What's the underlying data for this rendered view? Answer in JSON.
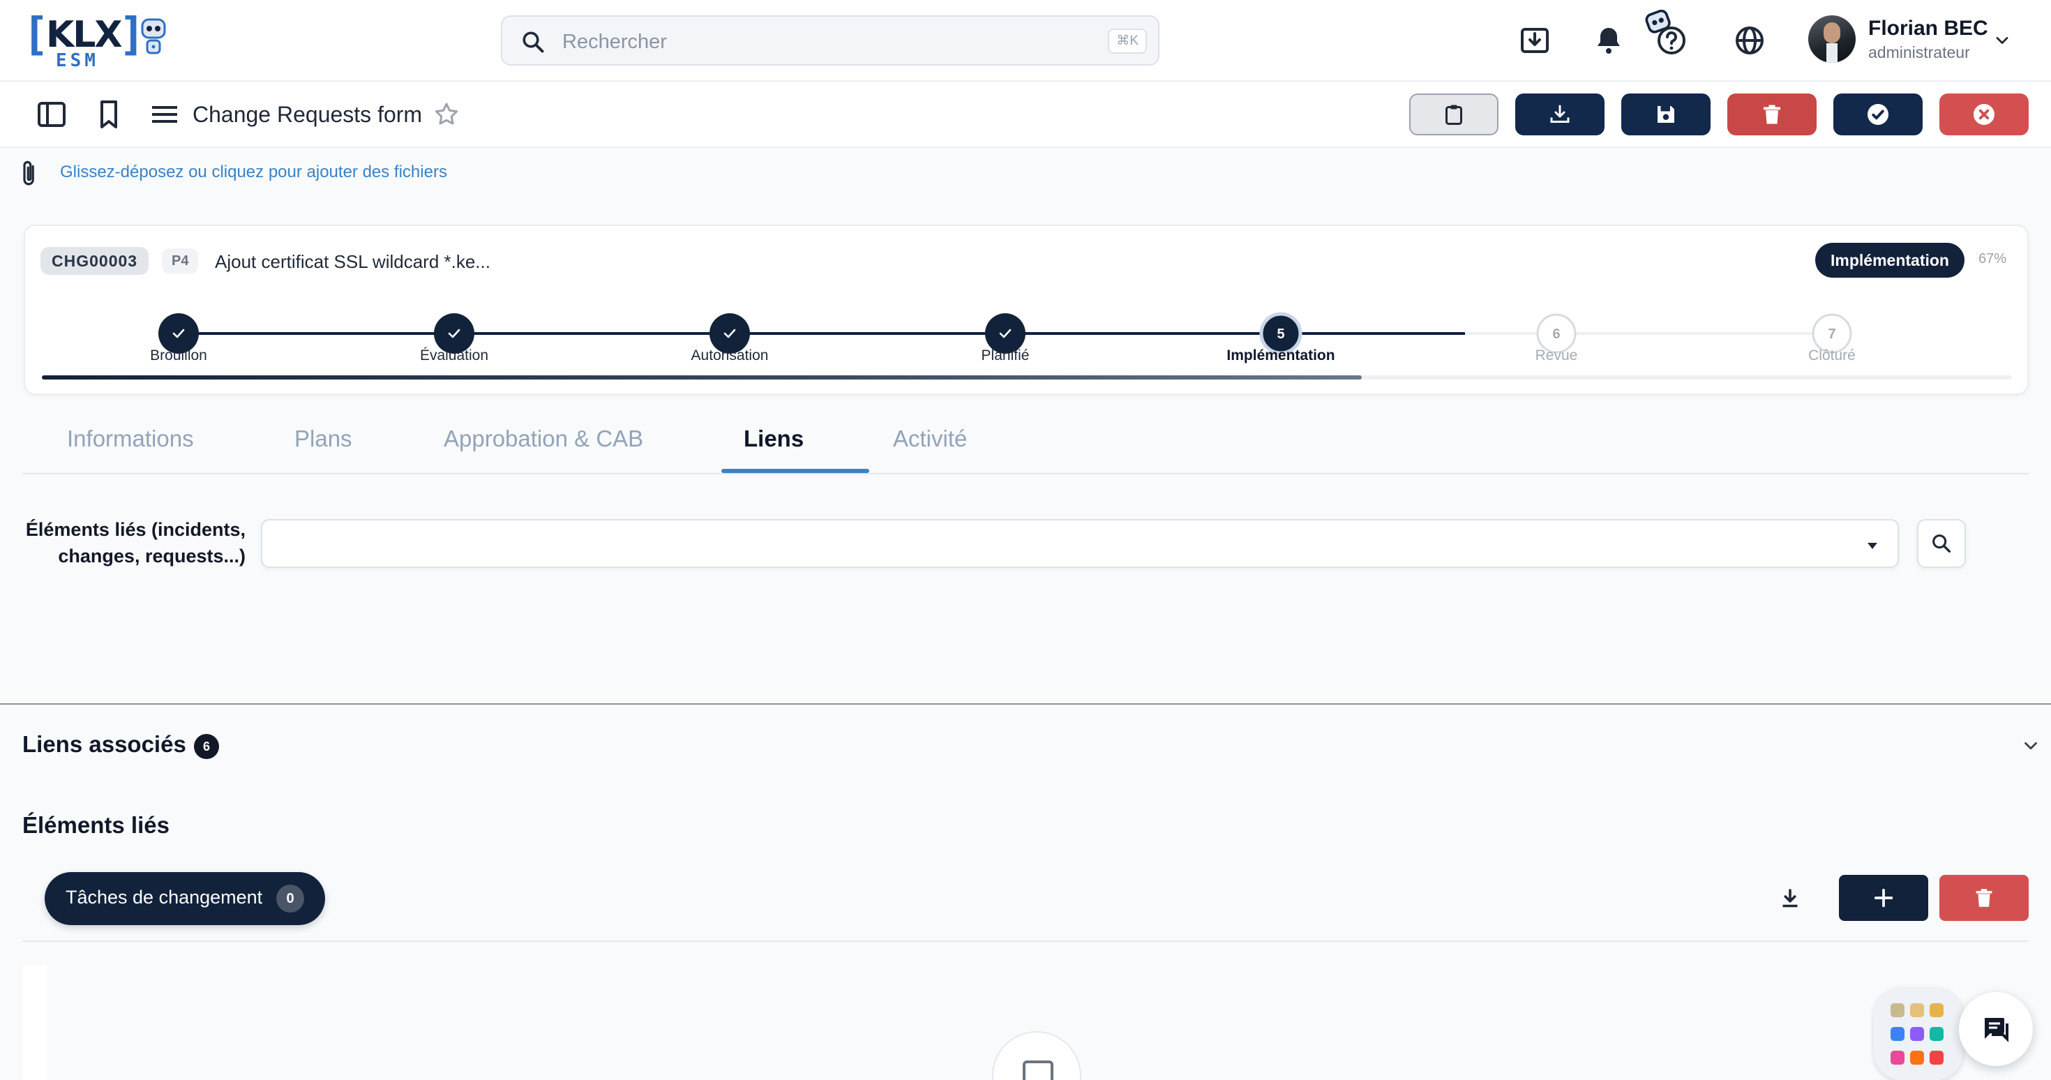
{
  "app": {
    "logo_text": "KLX",
    "logo_sub": "ESM"
  },
  "header": {
    "search_placeholder": "Rechercher",
    "search_shortcut": "⌘K",
    "user_name": "Florian BEC",
    "user_role": "administrateur"
  },
  "toolbar": {
    "form_title": "Change Requests form"
  },
  "attachments": {
    "hint": "Glissez-déposez ou cliquez pour ajouter des fichiers"
  },
  "record": {
    "id": "CHG00003",
    "priority": "P4",
    "title": "Ajout certificat SSL wildcard *.ke...",
    "status": "Implémentation",
    "progress_label": "67%",
    "progress": 0.67,
    "steps": [
      {
        "label": "Brouillon",
        "state": "done",
        "num": "1"
      },
      {
        "label": "Évaluation",
        "state": "done",
        "num": "2"
      },
      {
        "label": "Autorisation",
        "state": "done",
        "num": "3"
      },
      {
        "label": "Planifié",
        "state": "done",
        "num": "4"
      },
      {
        "label": "Implémentation",
        "state": "active",
        "num": "5"
      },
      {
        "label": "Revue",
        "state": "todo",
        "num": "6"
      },
      {
        "label": "Clôturé",
        "state": "todo",
        "num": "7"
      }
    ]
  },
  "tabs": [
    {
      "label": "Informations"
    },
    {
      "label": "Plans"
    },
    {
      "label": "Approbation & CAB"
    },
    {
      "label": "Liens"
    },
    {
      "label": "Activité"
    }
  ],
  "links_form": {
    "label_line1": "Éléments liés (incidents,",
    "label_line2": "changes, requests...)"
  },
  "associated": {
    "title": "Liens associés",
    "count": "6",
    "subtitle": "Éléments liés",
    "tasks_label": "Tâches de changement",
    "tasks_count": "0"
  },
  "colors": {
    "navy": "#13223b",
    "danger": "#d45050",
    "accent": "#3b82c4"
  }
}
